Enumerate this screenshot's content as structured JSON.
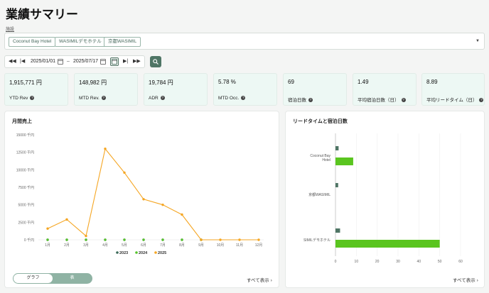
{
  "page": {
    "title": "業績サマリー"
  },
  "filter": {
    "label": "施設",
    "chips": [
      "Coconut Bay Hotel",
      "WASIMILデモホテル",
      "京都WASIMIL"
    ],
    "dropdown_icon": "caret-down-icon"
  },
  "date_range": {
    "start": "2025/01/01",
    "end": "2025/07/17",
    "separator": "–",
    "icons": [
      "double-chevron-left-icon",
      "skip-back-icon",
      "calendar-icon",
      "skip-forward-icon",
      "double-chevron-right-icon",
      "search-icon"
    ]
  },
  "kpis": [
    {
      "value": "1,915,771 円",
      "label": "YTD Rev"
    },
    {
      "value": "148,982 円",
      "label": "MTD Rev."
    },
    {
      "value": "19,784 円",
      "label": "ADR"
    },
    {
      "value": "5.78 %",
      "label": "MTD Occ."
    },
    {
      "value": "69",
      "label": "宿泊日数"
    },
    {
      "value": "1.49",
      "label": "平均宿泊日数（日）"
    },
    {
      "value": "8.89",
      "label": "平均リードタイム（日）"
    }
  ],
  "monthly_panel": {
    "title": "月間売上",
    "toggle": {
      "graph": "グラフ",
      "table": "表"
    },
    "show_all": "すべて表示 ›"
  },
  "lead_panel": {
    "title": "リードタイムと宿泊日数",
    "show_all": "すべて表示 ›"
  },
  "colors": {
    "accent": "#4f7565",
    "kpi_bg": "#edf8f4",
    "series_2023": "#3d6b5a",
    "series_2024": "#56c22c",
    "series_2025": "#f5a623",
    "bar_dark": "#4f7565",
    "bar_green": "#5ac51f"
  },
  "chart_data": [
    {
      "type": "line",
      "title": "月間売上",
      "categories": [
        "1月",
        "2月",
        "3月",
        "4月",
        "5月",
        "6月",
        "7月",
        "8月",
        "9月",
        "10月",
        "11月",
        "12月"
      ],
      "y_ticks": [
        "0 千円",
        "2500 千円",
        "5000 千円",
        "7500 千円",
        "10000 千円",
        "12500 千円",
        "15000 千円"
      ],
      "ylim": [
        0,
        15000
      ],
      "legend_position": "bottom",
      "series": [
        {
          "name": "2023",
          "values": [
            0,
            0,
            0,
            0,
            0,
            0,
            0,
            0,
            0,
            null,
            null,
            null
          ]
        },
        {
          "name": "2024",
          "values": [
            0,
            0,
            0,
            0,
            0,
            0,
            0,
            0,
            0,
            null,
            null,
            null
          ]
        },
        {
          "name": "2025",
          "values": [
            1600,
            2900,
            550,
            13000,
            9600,
            5800,
            5000,
            3600,
            0,
            0,
            0,
            0
          ]
        }
      ]
    },
    {
      "type": "bar",
      "orientation": "horizontal",
      "title": "リードタイムと宿泊日数",
      "categories": [
        "Coconut Bay\nHotel",
        "京都WASIMIL",
        "SIMILデモホテル"
      ],
      "x_ticks": [
        "0",
        "10",
        "20",
        "30",
        "40",
        "50",
        "60"
      ],
      "xlim": [
        0,
        60
      ],
      "series": [
        {
          "values": [
            1.5,
            1.3,
            2.2
          ]
        },
        {
          "values": [
            8.5,
            0,
            50
          ]
        }
      ]
    }
  ]
}
